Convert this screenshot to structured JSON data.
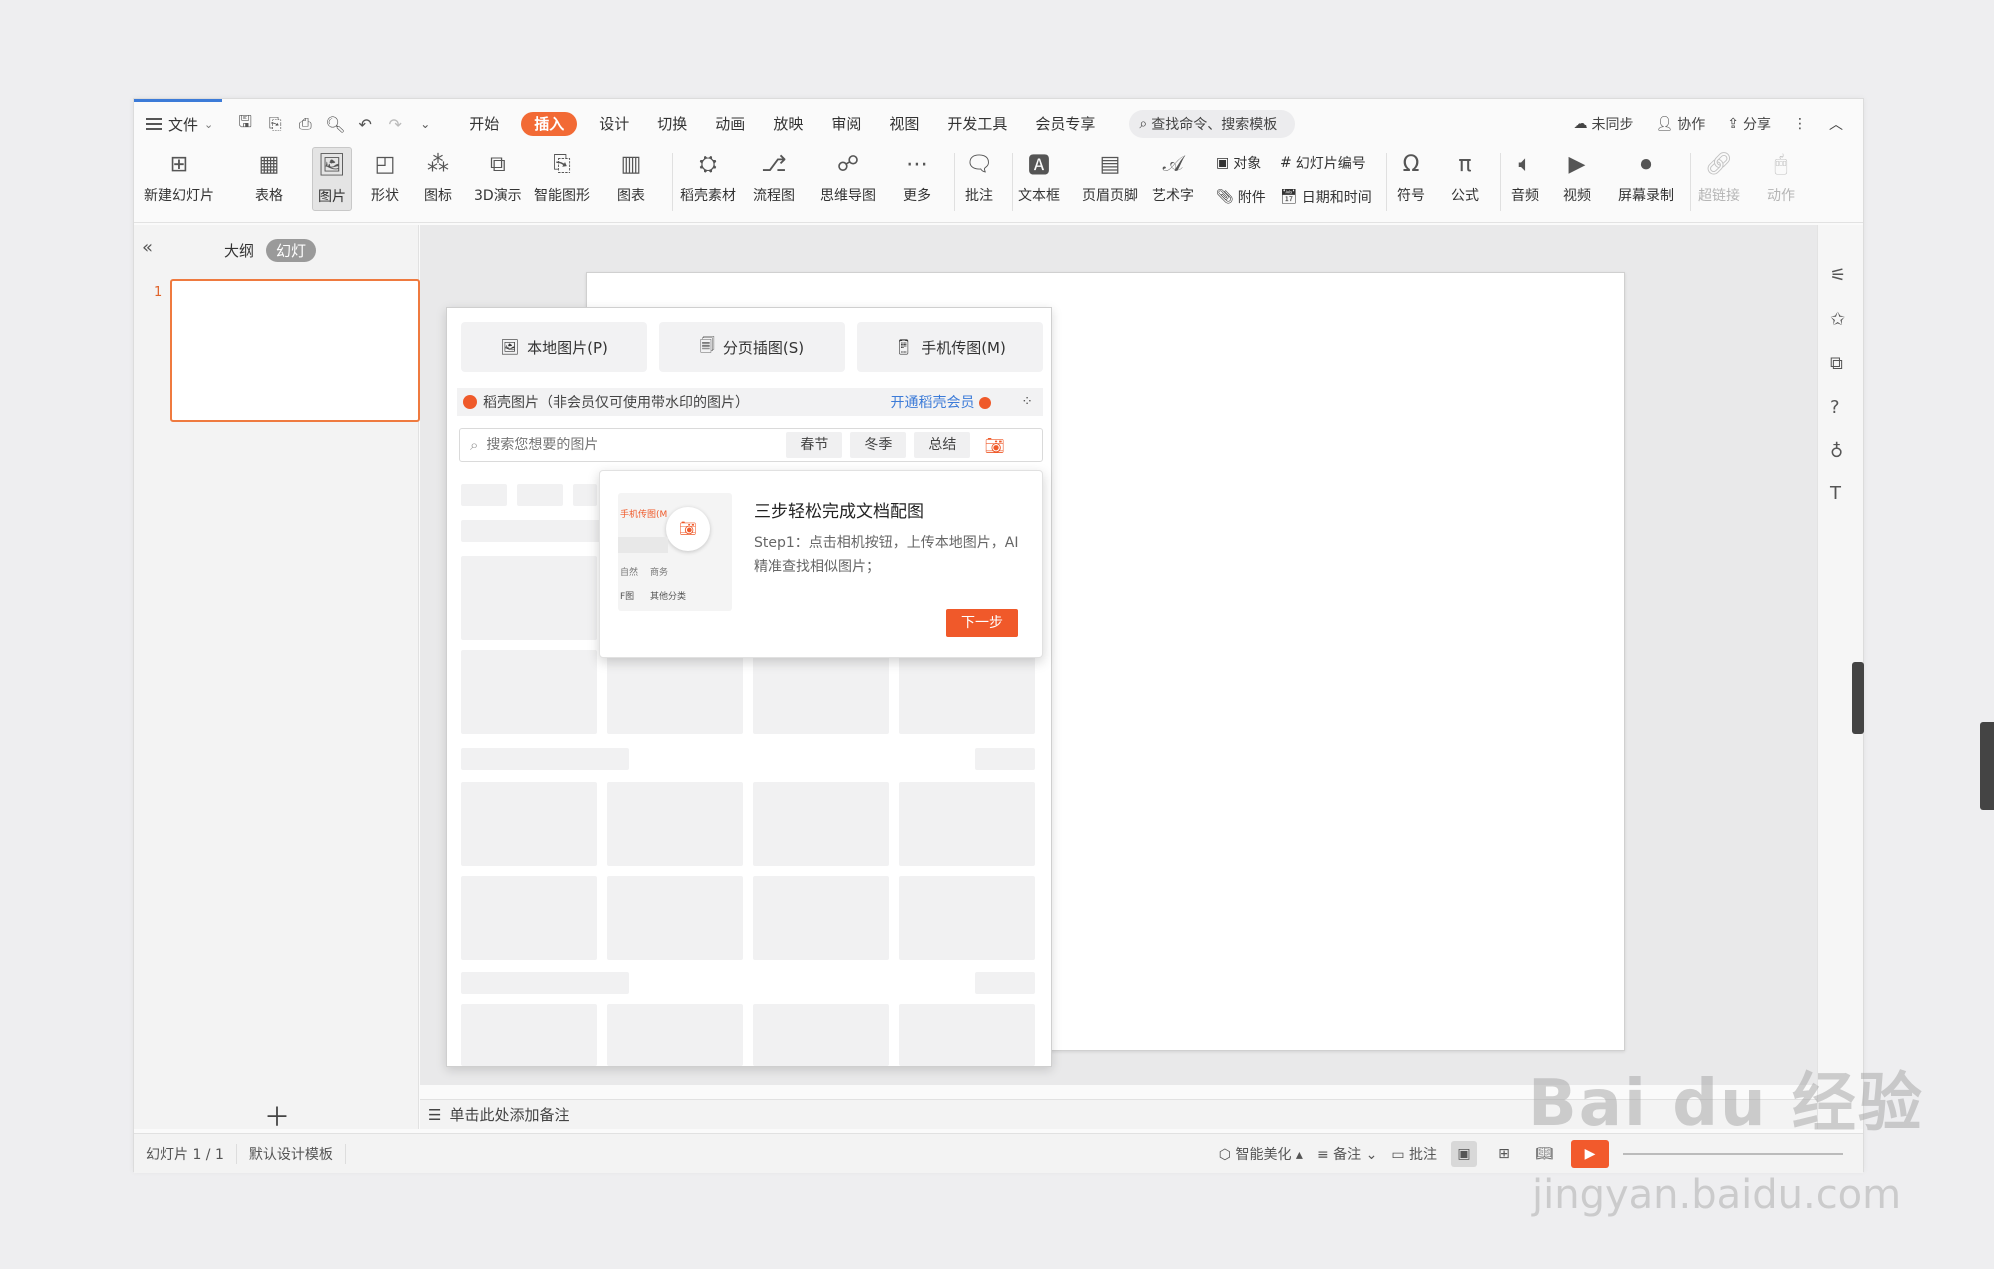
{
  "menubar": {
    "file_label": "文件",
    "tabs": [
      "开始",
      "插入",
      "设计",
      "切换",
      "动画",
      "放映",
      "审阅",
      "视图",
      "开发工具",
      "会员专享"
    ],
    "active_tab": "插入",
    "search_label": "查找命令、搜索模板",
    "right": {
      "unsync": "未同步",
      "collab": "协作",
      "share": "分享"
    }
  },
  "ribbon": {
    "new_slide": "新建幻灯片",
    "table": "表格",
    "picture": "图片",
    "shape": "形状",
    "icon": "图标",
    "demo3d": "3D演示",
    "smartart": "智能图形",
    "chart": "图表",
    "material": "稻壳素材",
    "flow": "流程图",
    "mindmap": "思维导图",
    "more": "更多",
    "comment": "批注",
    "textbox": "文本框",
    "headerfooter": "页眉页脚",
    "wordart": "艺术字",
    "object": "对象",
    "attachment": "附件",
    "slide_number": "幻灯片编号",
    "datetime": "日期和时间",
    "symbol": "符号",
    "formula": "公式",
    "audio": "音频",
    "video": "视频",
    "screen_record": "屏幕录制",
    "hyperlink": "超链接",
    "action": "动作"
  },
  "leftpane": {
    "outline": "大纲",
    "slides": "幻灯",
    "slide_num": "1"
  },
  "notes": {
    "placeholder": "单击此处添加备注"
  },
  "statusbar": {
    "slide_count": "幻灯片 1 / 1",
    "template": "默认设计模板",
    "beautify": "智能美化",
    "notes": "备注",
    "comment": "批注"
  },
  "dropdown": {
    "buttons": [
      "本地图片(P)",
      "分页插图(S)",
      "手机传图(M)"
    ],
    "strip_text": "稻壳图片（非会员仅可使用带水印的图片）",
    "strip_link": "开通稻壳会员",
    "search_placeholder": "搜索您想要的图片",
    "chips": [
      "春节",
      "冬季",
      "总结"
    ],
    "tip": {
      "title": "三步轻松完成文档配图",
      "body": "Step1：点击相机按钮，上传本地图片，AI精准查找相似图片；",
      "next": "下一步",
      "mini_title": "手机传图(M",
      "mini_tags": [
        "自然",
        "商务",
        "F图",
        "其他分类"
      ]
    }
  },
  "watermark": {
    "logo": "Bai du 经验",
    "url": "jingyan.baidu.com"
  },
  "colors": {
    "accent": "#f26a35",
    "link": "#3c7bd8"
  }
}
